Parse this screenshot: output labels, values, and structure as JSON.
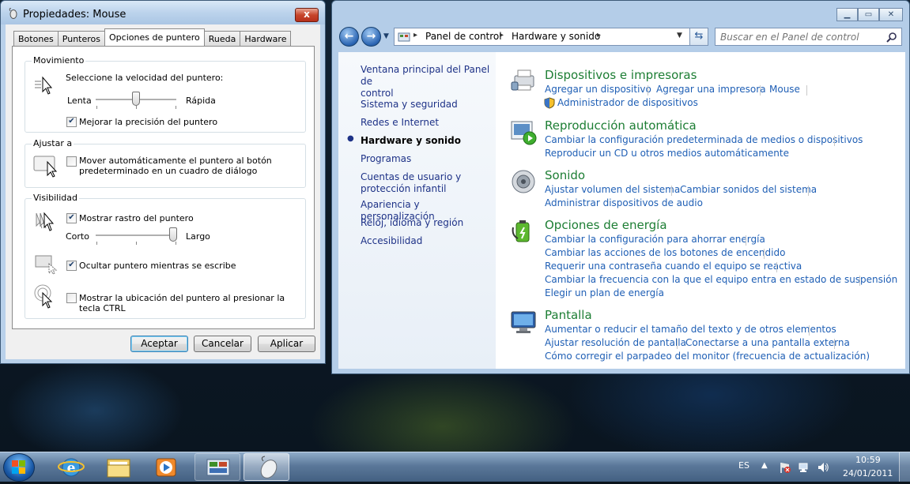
{
  "mouse_dialog": {
    "title": "Propiedades: Mouse",
    "close_glyph": "x",
    "tabs": [
      "Botones",
      "Punteros",
      "Opciones de puntero",
      "Rueda",
      "Hardware"
    ],
    "active_tab": "Opciones de puntero",
    "movement": {
      "group_label": "Movimiento",
      "speed_prompt": "Seleccione la velocidad del puntero:",
      "slow_label": "Lenta",
      "fast_label": "Rápida",
      "speed_level": 0.5,
      "precision_label": "Mejorar la precisión del puntero",
      "precision_checked": true
    },
    "snap_to": {
      "group_label": "Ajustar a",
      "label_line1": "Mover automáticamente el puntero al botón",
      "label_line2": "predeterminado en un cuadro de diálogo",
      "checked": false
    },
    "visibility": {
      "group_label": "Visibilidad",
      "trails_label": "Mostrar rastro del puntero",
      "trails_checked": true,
      "short_label": "Corto",
      "long_label": "Largo",
      "trail_level": 1.0,
      "hide_label": "Ocultar puntero mientras se escribe",
      "hide_checked": true,
      "ctrl_label": "Mostrar la ubicación del puntero al presionar la tecla CTRL",
      "ctrl_checked": false
    },
    "buttons": {
      "ok": "Aceptar",
      "cancel": "Cancelar",
      "apply": "Aplicar"
    }
  },
  "control_panel": {
    "breadcrumb": [
      "Panel de control",
      "Hardware y sonido"
    ],
    "search_placeholder": "Buscar en el Panel de control",
    "nav": [
      "Ventana principal del Panel de control",
      "Sistema y seguridad",
      "Redes e Internet",
      "Hardware y sonido",
      "Programas",
      "Cuentas de usuario y protección infantil",
      "Apariencia y personalización",
      "Reloj, idioma y región",
      "Accesibilidad"
    ],
    "nav_main_line1": "Ventana principal del Panel de",
    "nav_main_line2": "control",
    "nav_accounts_line1": "Cuentas de usuario y",
    "nav_accounts_line2": "protección infantil",
    "current_nav": "Hardware y sonido",
    "categories": [
      {
        "title": "Dispositivos e impresoras",
        "links": [
          "Agregar un dispositivo",
          "Agregar una impresora",
          "Mouse",
          "Administrador de dispositivos"
        ]
      },
      {
        "title": "Reproducción automática",
        "links": [
          "Cambiar la configuración predeterminada de medios o dispositivos",
          "Reproducir un CD u otros medios automáticamente"
        ]
      },
      {
        "title": "Sonido",
        "links": [
          "Ajustar volumen del sistema",
          "Cambiar sonidos del sistema",
          "Administrar dispositivos de audio"
        ]
      },
      {
        "title": "Opciones de energía",
        "links": [
          "Cambiar la configuración para ahorrar energía",
          "Cambiar las acciones de los botones de encendido",
          "Requerir una contraseña cuando el equipo se reactiva",
          "Cambiar la frecuencia con la que el equipo entra en estado de suspensión",
          "Elegir un plan de energía"
        ]
      },
      {
        "title": "Pantalla",
        "links": [
          "Aumentar o reducir el tamaño del texto y de otros elementos",
          "Ajustar resolución de pantalla",
          "Conectarse a una pantalla externa",
          "Cómo corregir el parpadeo del monitor (frecuencia de actualización)"
        ]
      }
    ]
  },
  "taskbar": {
    "language": "ES",
    "time": "10:59",
    "date": "24/01/2011"
  },
  "colors": {
    "link": "#1f5fb5",
    "category_title": "#1d7e34",
    "nav_link": "#1e3287"
  }
}
